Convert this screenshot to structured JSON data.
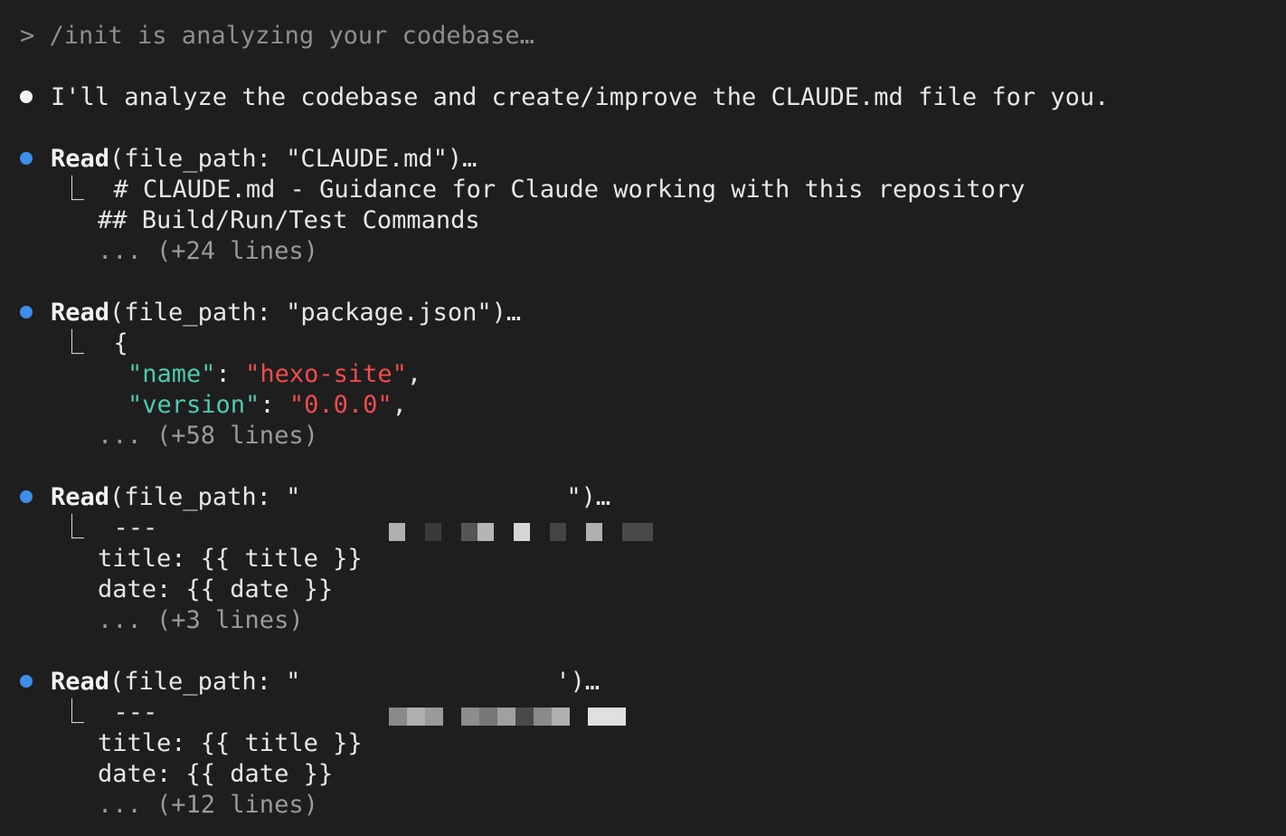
{
  "prompt_line": "> /init is analyzing your codebase…",
  "assistant_message": "I'll analyze the codebase and create/improve the CLAUDE.md file for you.",
  "colors": {
    "background": "#1e1e1e",
    "tool_dot": "#3b8eea",
    "message_dot": "#f2f2f2",
    "json_key": "#4ec9b0",
    "json_string": "#f14c4c",
    "dim_text": "#9a9a9a"
  },
  "tool_calls": [
    {
      "tool": "Read",
      "args_prefix": "(file_path: \"CLAUDE.md\")…",
      "output": [
        "# CLAUDE.md - Guidance for Claude working with this repository",
        "## Build/Run/Test Commands"
      ],
      "more": "... (+24 lines)"
    },
    {
      "tool": "Read",
      "args_prefix": "(file_path: \"package.json\")…",
      "output_open": "{",
      "json_lines": [
        {
          "key": "\"name\"",
          "sep": ": ",
          "value": "\"hexo-site\"",
          "trail": ","
        },
        {
          "key": "\"version\"",
          "sep": ": ",
          "value": "\"0.0.0\"",
          "trail": ","
        }
      ],
      "more": "... (+58 lines)"
    },
    {
      "tool": "Read",
      "args_open": "(file_path: \"",
      "args_close": "\")…",
      "redacted": true,
      "output": [
        "---",
        "title: {{ title }}",
        "date: {{ date }}"
      ],
      "more": "... (+3 lines)"
    },
    {
      "tool": "Read",
      "args_open": "(file_path: \"",
      "args_close": "')…",
      "redacted": true,
      "output": [
        "---",
        "title: {{ title }}",
        "date: {{ date }}"
      ],
      "more": "... (+12 lines)"
    }
  ],
  "tree_glyph": "⎿"
}
